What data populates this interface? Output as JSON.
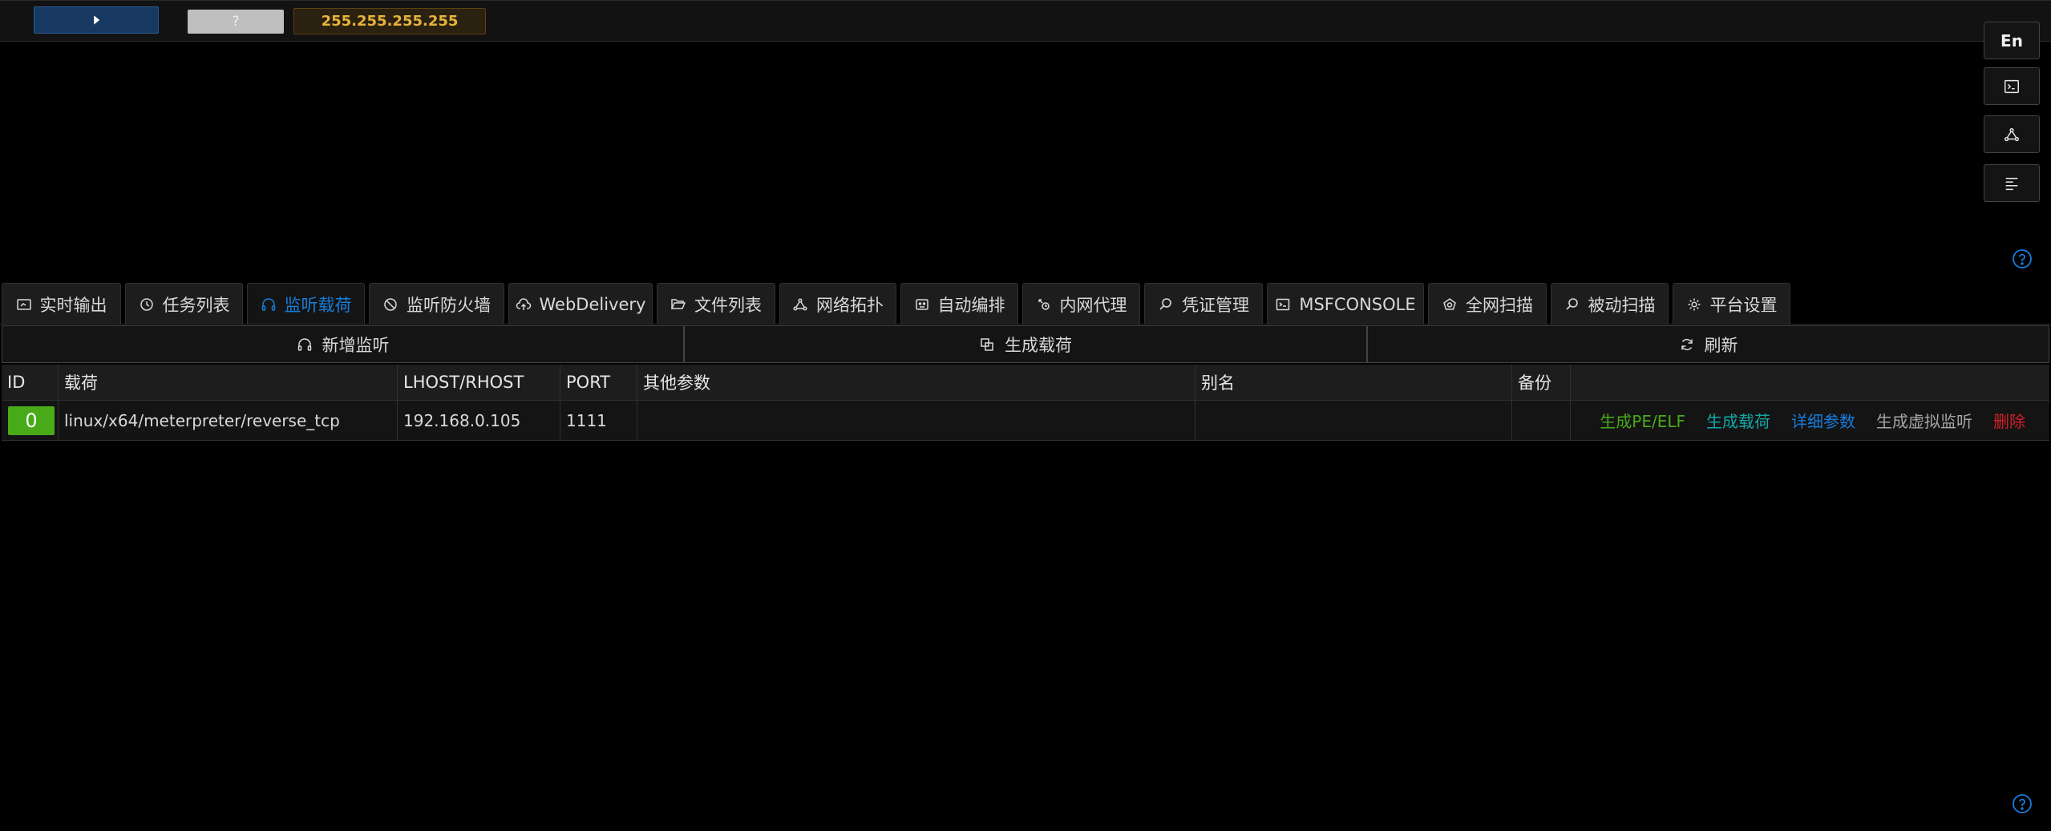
{
  "topbar": {
    "help_label": "?",
    "ip_address": "255.255.255.255"
  },
  "side": {
    "lang_label": "En"
  },
  "tabs": [
    {
      "label": "实时输出",
      "icon": "dashboard-icon"
    },
    {
      "label": "任务列表",
      "icon": "clock-icon"
    },
    {
      "label": "监听载荷",
      "icon": "headphones-icon",
      "active": true
    },
    {
      "label": "监听防火墙",
      "icon": "stop-icon"
    },
    {
      "label": "WebDelivery",
      "icon": "cloud-upload-icon"
    },
    {
      "label": "文件列表",
      "icon": "folder-open-icon"
    },
    {
      "label": "网络拓扑",
      "icon": "topology-icon"
    },
    {
      "label": "自动编排",
      "icon": "robot-icon"
    },
    {
      "label": "内网代理",
      "icon": "proxy-icon"
    },
    {
      "label": "凭证管理",
      "icon": "search-icon"
    },
    {
      "label": "MSFCONSOLE",
      "icon": "terminal-icon"
    },
    {
      "label": "全网扫描",
      "icon": "radar-icon"
    },
    {
      "label": "被动扫描",
      "icon": "search-icon"
    },
    {
      "label": "平台设置",
      "icon": "gear-icon"
    }
  ],
  "actions": {
    "add_listener": "新增监听",
    "generate_payload": "生成载荷",
    "refresh": "刷新"
  },
  "table": {
    "columns": [
      "ID",
      "载荷",
      "LHOST/RHOST",
      "PORT",
      "其他参数",
      "别名",
      "备份",
      ""
    ],
    "rows": [
      {
        "id": "0",
        "payload": "linux/x64/meterpreter/reverse_tcp",
        "host": "192.168.0.105",
        "port": "1111",
        "other": "",
        "alias": "",
        "backup": "",
        "ops": {
          "gen_pe_elf": "生成PE/ELF",
          "gen_payload": "生成载荷",
          "detail_params": "详细参数",
          "gen_virtual_listener": "生成虚拟监听",
          "delete": "删除"
        }
      }
    ]
  },
  "colors": {
    "accent": "#177ddc",
    "ip_text": "#e8b339",
    "id_tag": "#49aa19",
    "op_gen_pe": "#49aa19",
    "op_gen_payload": "#13a8a8",
    "op_detail": "#177ddc",
    "op_virtual": "#a6a6a6",
    "op_delete": "#d32029"
  }
}
